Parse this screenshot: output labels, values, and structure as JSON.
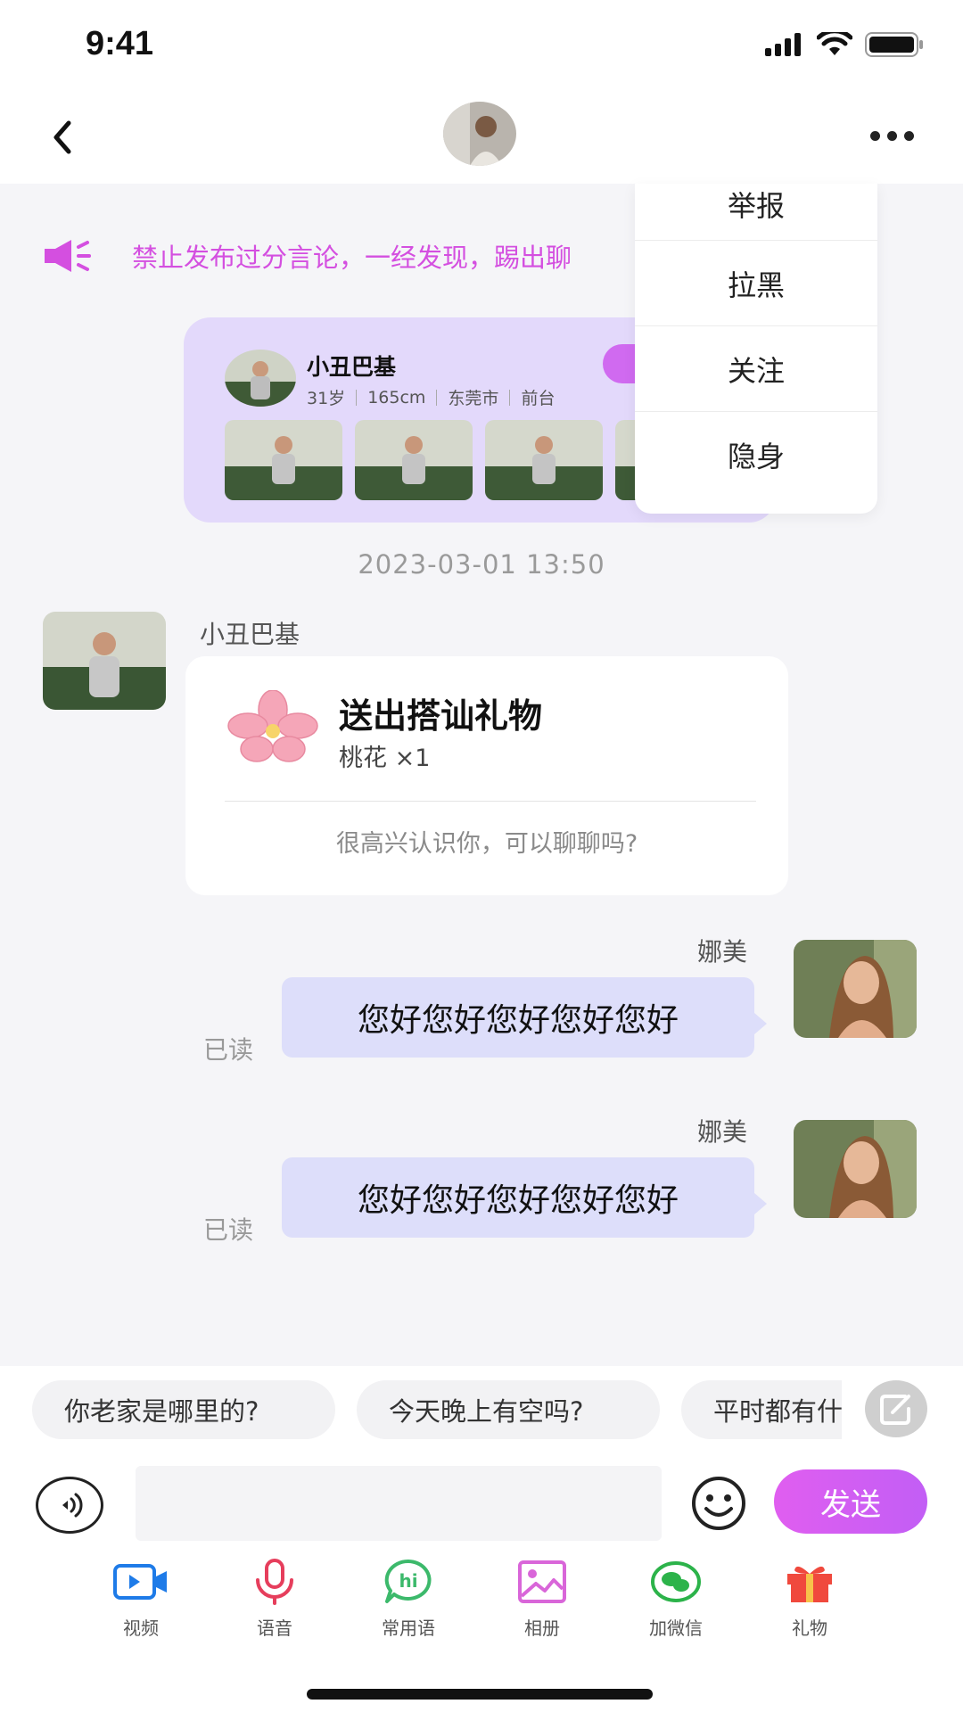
{
  "status_bar": {
    "time": "9:41"
  },
  "notice": {
    "text": "禁止发布过分言论，一经发现，踢出聊"
  },
  "profile_card": {
    "name": "小丑巴基",
    "age": "31岁",
    "height": "165cm",
    "city": "东莞市",
    "job": "前台"
  },
  "menu": {
    "items": [
      "举报",
      "拉黑",
      "关注",
      "隐身"
    ]
  },
  "timestamp": "2023-03-01  13:50",
  "gift_message": {
    "sender": "小丑巴基",
    "title": "送出搭讪礼物",
    "gift": "桃花 ×1",
    "text": "很高兴认识你，可以聊聊吗?"
  },
  "messages": [
    {
      "sender": "娜美",
      "text": "您好您好您好您好您好",
      "status": "已读"
    },
    {
      "sender": "娜美",
      "text": "您好您好您好您好您好",
      "status": "已读"
    }
  ],
  "quick_replies": [
    "你老家是哪里的?",
    "今天晚上有空吗?",
    "平时都有什么爱好"
  ],
  "input": {
    "placeholder": "",
    "send_label": "发送"
  },
  "tools": [
    {
      "label": "视频",
      "icon": "video-icon",
      "color": "#1e7be8"
    },
    {
      "label": "语音",
      "icon": "microphone-icon",
      "color": "#e63e5c"
    },
    {
      "label": "常用语",
      "icon": "hi-bubble-icon",
      "color": "#3cb96b"
    },
    {
      "label": "相册",
      "icon": "album-icon",
      "color": "#d966d9"
    },
    {
      "label": "加微信",
      "icon": "wechat-icon",
      "color": "#2cb34a"
    },
    {
      "label": "礼物",
      "icon": "gift-icon",
      "color": "#f0493d"
    }
  ],
  "colors": {
    "accent": "#d44fe0",
    "bubble": "#dddefa",
    "chat_bg": "#f5f5f8"
  }
}
